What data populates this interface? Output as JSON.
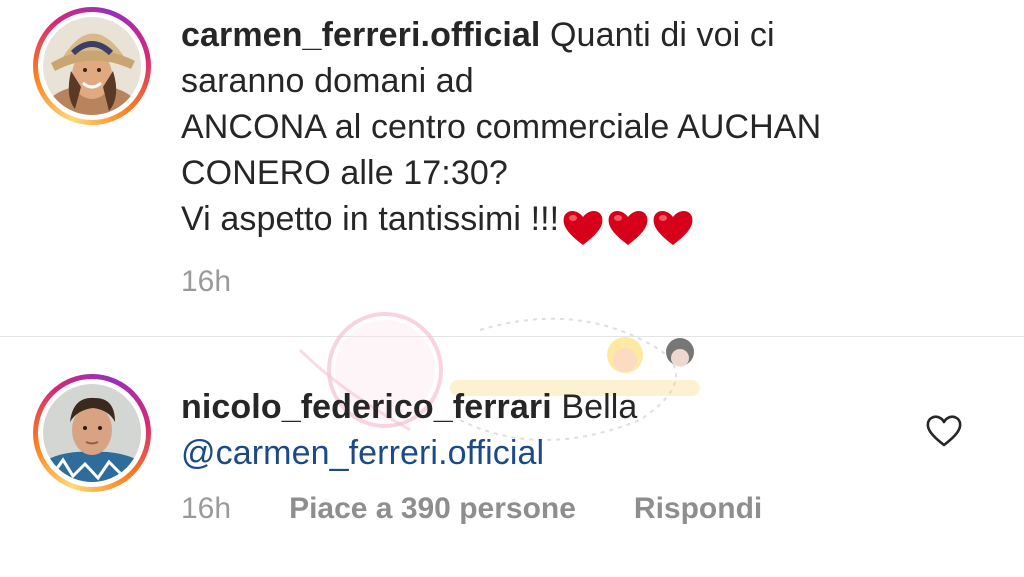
{
  "comment_1": {
    "username": "carmen_ferreri.official",
    "line_1": "Quanti di voi ci",
    "line_2": "saranno domani ad",
    "line_3": "ANCONA al centro commerciale AUCHAN",
    "line_4": "CONERO alle 17:30?",
    "line_5": "Vi aspetto in tantissimi !!!",
    "timestamp": "16h"
  },
  "comment_2": {
    "username": "nicolo_federico_ferrari",
    "text": "Bella",
    "mention": "@carmen_ferreri.official",
    "timestamp": "16h",
    "likes": "Piace a 390 persone",
    "reply": "Rispondi"
  },
  "colors": {
    "heart": "#d7001a",
    "mention": "#1c4a86",
    "meta": "#9a9a9a"
  },
  "icons": [
    "heart-emoji",
    "like-heart-icon"
  ]
}
